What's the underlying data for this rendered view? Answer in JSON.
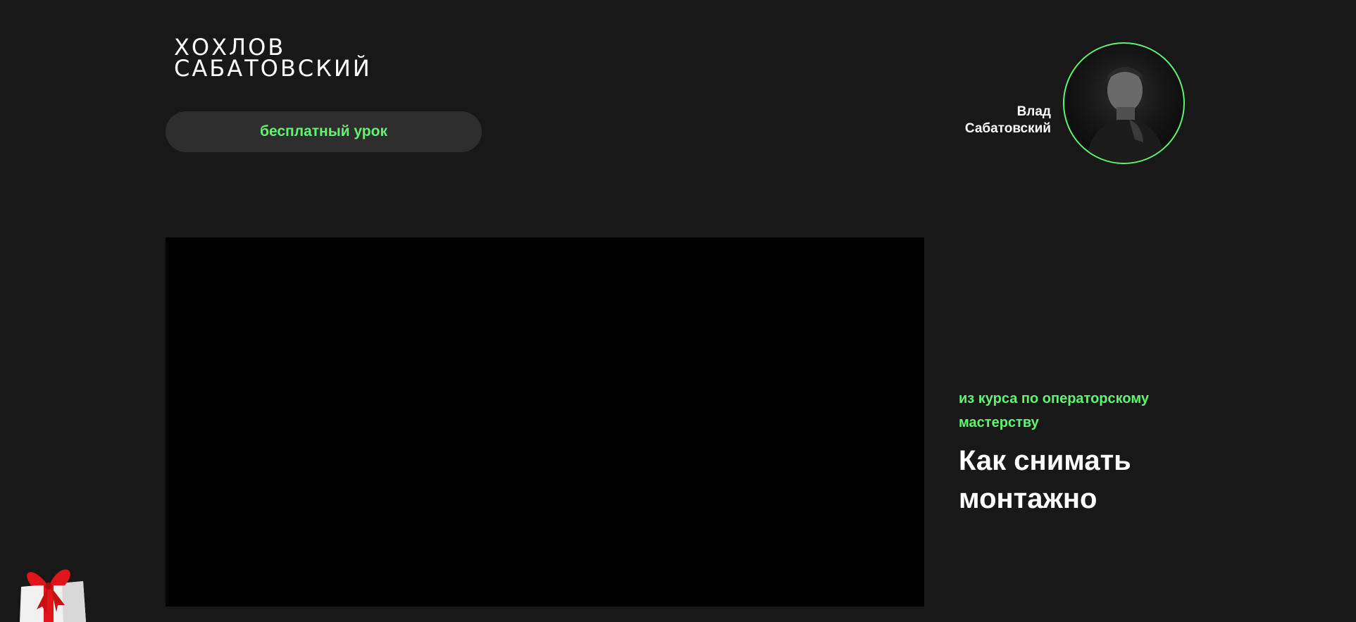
{
  "header": {
    "logo": {
      "line1": "ХОХЛОВ",
      "line2": "САБАТОВСКИЙ"
    },
    "lesson_button_label": "бесплатный урок"
  },
  "author": {
    "first_name": "Влад",
    "last_name": "Сабатовский"
  },
  "course": {
    "subtitle": "из курса по операторскому мастерству",
    "title": "Как снимать монтажно"
  },
  "colors": {
    "background": "#181818",
    "accent": "#5df56e",
    "pill": "#2e2e2e",
    "video": "#000000"
  },
  "icons": {
    "gift": "gift-icon"
  }
}
